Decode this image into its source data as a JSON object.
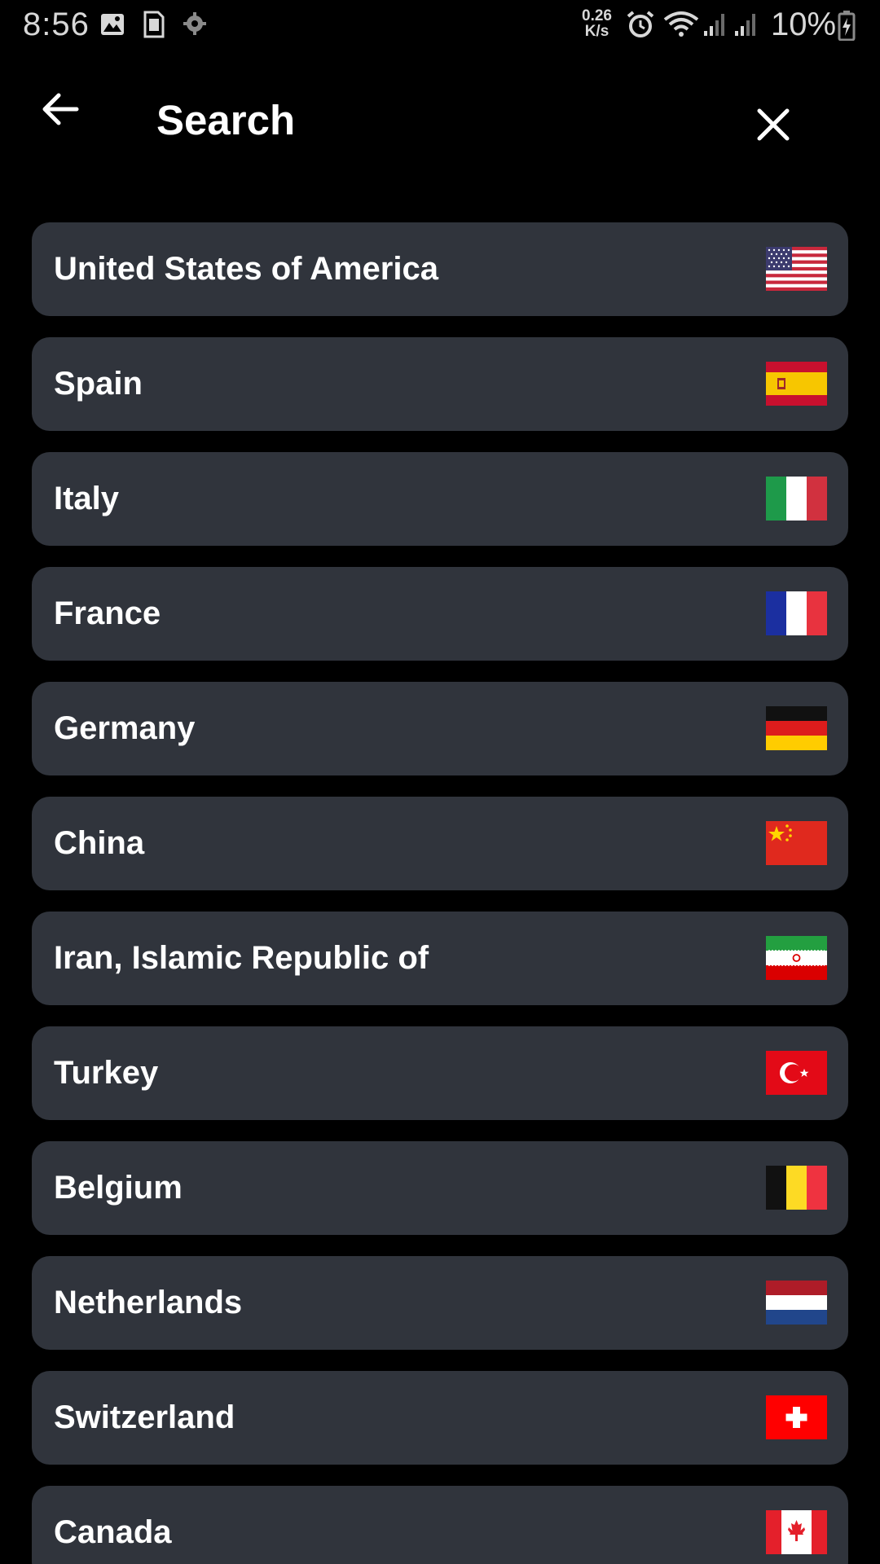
{
  "status_bar": {
    "time": "8:56",
    "net_speed_value": "0.26",
    "net_speed_unit": "K/s",
    "battery_percent": "10%",
    "icons": [
      "image-icon",
      "sim-card-icon",
      "settings-cog-icon",
      "alarm-icon",
      "wifi-icon",
      "signal-icon",
      "signal-icon-2",
      "battery-charging-icon"
    ]
  },
  "header": {
    "title": "Search",
    "back_icon": "arrow-back-icon",
    "close_icon": "close-icon"
  },
  "countries": [
    {
      "name": "United States of America",
      "flag": "us-flag-icon"
    },
    {
      "name": "Spain",
      "flag": "spain-flag-icon"
    },
    {
      "name": "Italy",
      "flag": "italy-flag-icon"
    },
    {
      "name": "France",
      "flag": "france-flag-icon"
    },
    {
      "name": "Germany",
      "flag": "germany-flag-icon"
    },
    {
      "name": "China",
      "flag": "china-flag-icon"
    },
    {
      "name": "Iran, Islamic Republic of",
      "flag": "iran-flag-icon"
    },
    {
      "name": "Turkey",
      "flag": "turkey-flag-icon"
    },
    {
      "name": "Belgium",
      "flag": "belgium-flag-icon"
    },
    {
      "name": "Netherlands",
      "flag": "netherlands-flag-icon"
    },
    {
      "name": "Switzerland",
      "flag": "switzerland-flag-icon"
    },
    {
      "name": "Canada",
      "flag": "canada-flag-icon"
    }
  ],
  "colors": {
    "background": "#000000",
    "card": "#30343c",
    "text": "#ffffff"
  }
}
